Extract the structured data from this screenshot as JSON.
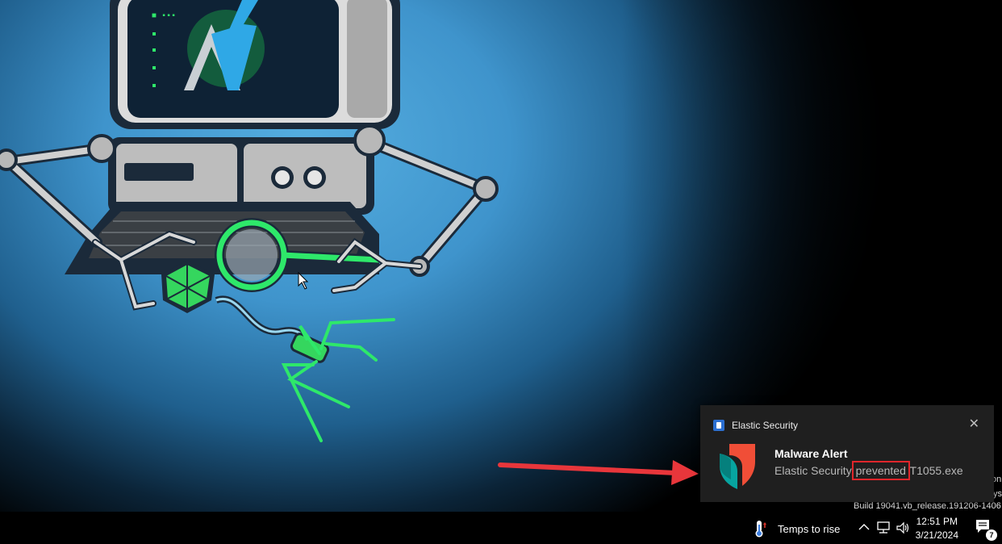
{
  "toast": {
    "app_name": "Elastic Security",
    "close_glyph": "✕",
    "title": "Malware Alert",
    "body_prefix": "Elastic Security ",
    "body_highlight": "prevented",
    "body_suffix": " T1055.exe",
    "brand_colors": {
      "logo_orange": "#f04e37",
      "logo_teal": "#07a4a0",
      "highlight_box": "#e0262b"
    }
  },
  "desktop": {
    "watermark_build": "Build 19041.vb_release.191206-1406",
    "watermark_partial_1": "on",
    "watermark_partial_2": "ys"
  },
  "annotation": {
    "arrow_color": "#e8363b"
  },
  "taskbar": {
    "weather_text": "Temps to rise",
    "weather_icon": "thermometer-icon",
    "tray_icons": [
      "chevron-up-icon",
      "network-icon",
      "speaker-icon"
    ],
    "time": "12:51 PM",
    "date": "3/21/2024",
    "notification_count": "7"
  }
}
